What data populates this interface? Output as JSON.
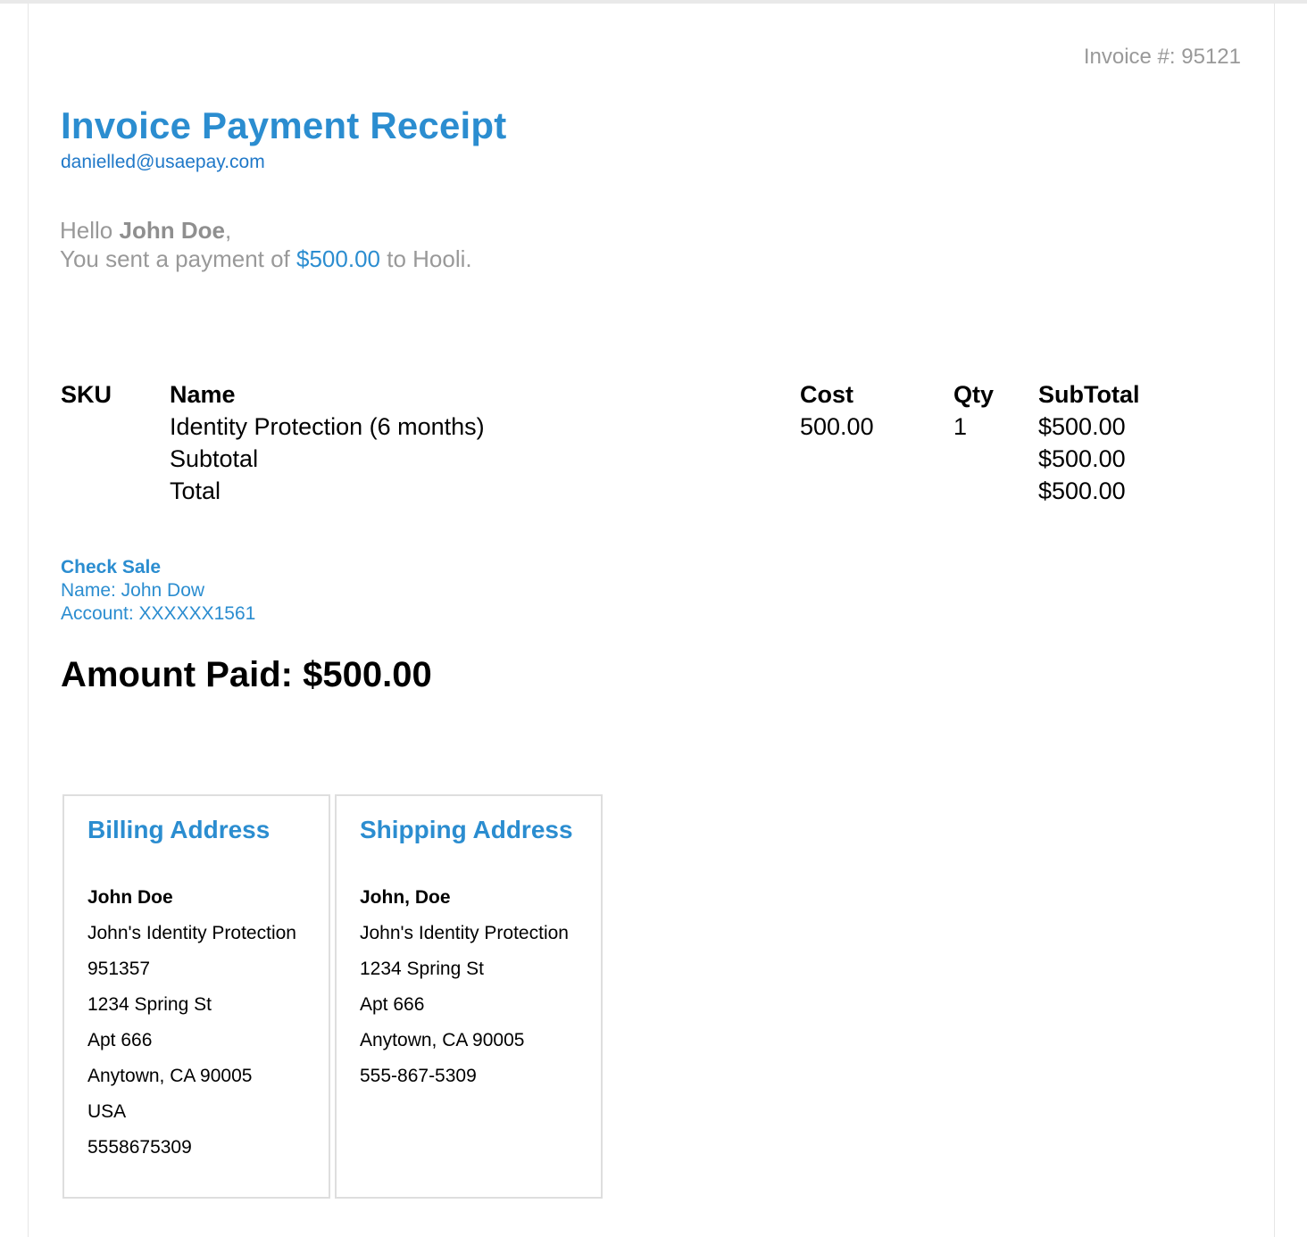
{
  "invoice": {
    "number_label": "Invoice #:",
    "number": "95121"
  },
  "header": {
    "title": "Invoice Payment Receipt",
    "merchant_email": "danielled@usaepay.com"
  },
  "greeting": {
    "hello": "Hello",
    "customer_name": "John Doe",
    "comma": ",",
    "sent_prefix": "You sent a payment of",
    "amount": "$500.00",
    "sent_suffix": "to Hooli."
  },
  "items": {
    "headers": {
      "sku": "SKU",
      "name": "Name",
      "cost": "Cost",
      "qty": "Qty",
      "subtotal": "SubTotal"
    },
    "rows": [
      {
        "sku": "",
        "name": "Identity Protection (6 months)",
        "cost": "500.00",
        "qty": "1",
        "subtotal": "$500.00"
      }
    ],
    "subtotal_label": "Subtotal",
    "subtotal_value": "$500.00",
    "total_label": "Total",
    "total_value": "$500.00"
  },
  "payment": {
    "method": "Check Sale",
    "name_line": "Name: John Dow",
    "account_line": "Account: XXXXXX1561"
  },
  "amount_paid": {
    "label": "Amount Paid:",
    "value": "$500.00"
  },
  "billing": {
    "title": "Billing Address",
    "lines": [
      "John Doe",
      "John's Identity Protection",
      "951357",
      "1234 Spring St",
      "Apt 666",
      "Anytown, CA 90005",
      "USA",
      "5558675309"
    ]
  },
  "shipping": {
    "title": "Shipping Address",
    "lines": [
      "John, Doe",
      "John's Identity Protection",
      "1234 Spring St",
      "Apt 666",
      "Anytown, CA 90005",
      "555-867-5309"
    ]
  },
  "colors": {
    "accent": "#2b8dd0",
    "muted": "#999999",
    "text": "#000000",
    "border": "#dedede"
  }
}
